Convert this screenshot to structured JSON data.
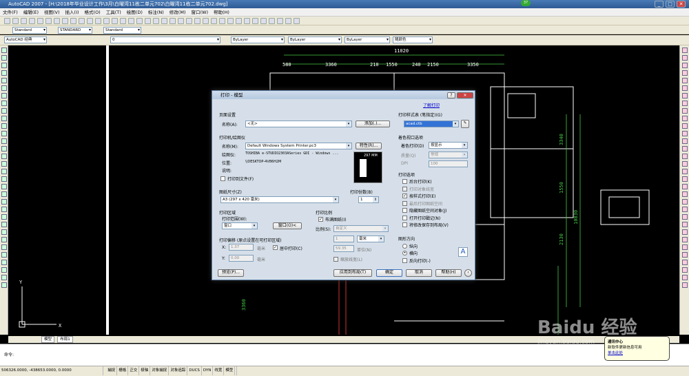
{
  "titlebar": {
    "text": "AutoCAD 2007 - [H:\\2018年毕业设计工作\\3月\\白曜湾11栋二单元702\\白曜湾11栋二单元702.dwg]",
    "badge": "37"
  },
  "menu": [
    "文件(F)",
    "编辑(E)",
    "视图(V)",
    "插入(I)",
    "格式(O)",
    "工具(T)",
    "绘图(D)",
    "标注(N)",
    "修改(M)",
    "窗口(W)",
    "帮助(H)"
  ],
  "toolbar2": {
    "text_style": "Standard",
    "dim_style": "STANDARD",
    "table_style": "Standard"
  },
  "toolbar3": {
    "workspace": "AutoCAD 经典",
    "layer": "0",
    "color": "ByLayer",
    "linetype": "ByLayer",
    "lineweight": "ByLayer",
    "plotstyle": "随颜色"
  },
  "drawing": {
    "top_total": "11020",
    "top_dims": [
      "580",
      "3360",
      "210",
      "1550",
      "240",
      "2150",
      "3350"
    ],
    "right_dims": [
      "3340",
      "1550",
      "2130",
      "10830"
    ],
    "left_dim": "3360"
  },
  "tabs": [
    "模型",
    "布局1"
  ],
  "command": {
    "prompt": "命令:"
  },
  "statusbar": {
    "coords": "506326.0000, -438653.0000, 0.0000",
    "buttons": [
      "捕捉",
      "栅格",
      "正交",
      "极轴",
      "对象捕捉",
      "对象追踪",
      "DUCS",
      "DYN",
      "线宽",
      "模型"
    ]
  },
  "dialog": {
    "title": "打印 - 模型",
    "learn_link": "了解打印",
    "page_setup": {
      "group": "页面设置",
      "name_label": "名称(A):",
      "name_value": "<无>",
      "add_button": "添加(.)..."
    },
    "printer": {
      "group": "打印机/绘图仪",
      "name_label": "名称(M):",
      "name_value": "Default Windows System Printer.pc3",
      "properties_button": "特性(R)...",
      "plotter_label": "绘图仪:",
      "plotter_value": "TOSHIBA e-STUDIO2303ASeries GDI - Windows ...",
      "location_label": "位置:",
      "location_value": "\\\\DESKTOP-4V86H2M",
      "desc_label": "说明:",
      "to_file": "打印到文件(F)",
      "preview_width": "297 MM"
    },
    "paper": {
      "group": "图纸尺寸(Z)",
      "value": "A3 (297 x 420 毫米)"
    },
    "copies": {
      "group": "打印份数(B)",
      "value": "1"
    },
    "area": {
      "group": "打印区域",
      "range_label": "打印范围(W):",
      "range_value": "窗口",
      "window_button": "窗口(O)<"
    },
    "scale": {
      "group": "打印比例",
      "fit": "布满图纸(I)",
      "scale_label": "比例(S):",
      "scale_value": "自定义",
      "v1": "1",
      "unit": "毫米",
      "v2": "59.35",
      "unit2": "单位(N)",
      "lineweights": "缩放线宽(L)"
    },
    "offset": {
      "group": "打印偏移 (原点设置在可打印区域)",
      "x_label": "X:",
      "x_value": "1.37",
      "x_unit": "毫米",
      "center": "居中打印(C)",
      "y_label": "Y:",
      "y_value": "0.00",
      "y_unit": "毫米"
    },
    "style_table": {
      "group": "打印样式表 (笔指定)(G)",
      "value": "acad.ctb"
    },
    "shaded": {
      "group": "着色视口选项",
      "shade_label": "着色打印(D)",
      "shade_value": "按显示",
      "quality_label": "质量(Q)",
      "quality_value": "常规",
      "dpi_label": "DPI",
      "dpi_value": "100"
    },
    "options": {
      "group": "打印选项",
      "items": [
        "后台打印(K)",
        "打印对象线宽",
        "按样式打印(E)",
        "最后打印图纸空间",
        "隐藏图纸空间对象(J)",
        "打开打印戳记(N)",
        "将修改保存到布局(V)"
      ]
    },
    "orientation": {
      "group": "图形方向",
      "portrait": "纵向",
      "landscape": "横向",
      "upside": "反向打印(-)"
    },
    "buttons": {
      "preview": "预览(P)...",
      "apply": "应用到布局(T)",
      "ok": "确定",
      "cancel": "取消",
      "help": "帮助(H)"
    }
  },
  "notification": {
    "title": "通讯中心",
    "line1": "新软件更新信息可用",
    "link": "单击此处"
  },
  "watermark": {
    "brand": "Baidu 经验",
    "url": "jingyan.baidu.com"
  }
}
